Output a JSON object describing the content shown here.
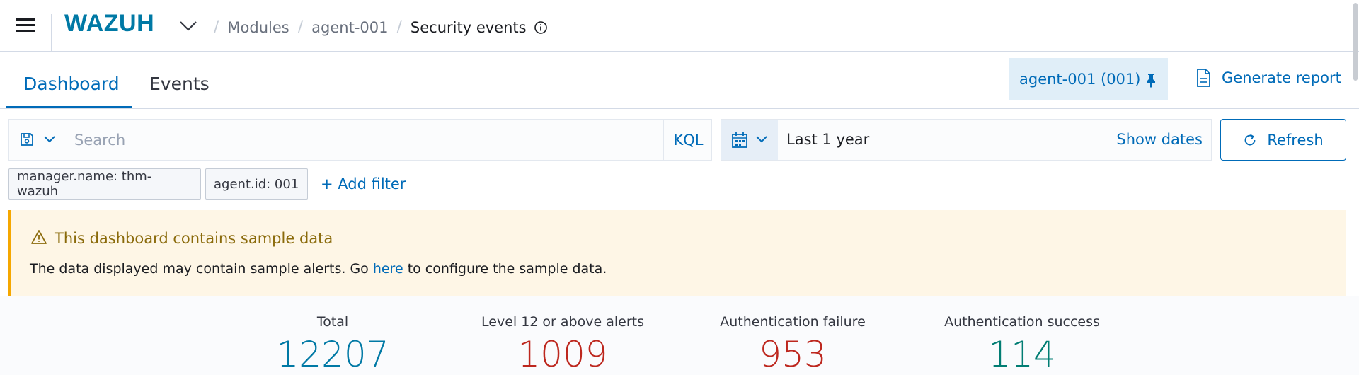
{
  "header": {
    "logo": "WAZUH",
    "breadcrumbs": [
      "Modules",
      "agent-001"
    ],
    "current": "Security events"
  },
  "tabs": [
    {
      "label": "Dashboard",
      "active": true
    },
    {
      "label": "Events",
      "active": false
    }
  ],
  "agent_pill": "agent-001 (001)",
  "generate_report": "Generate report",
  "search": {
    "placeholder": "Search",
    "value": "",
    "language": "KQL"
  },
  "date_picker": {
    "range": "Last 1 year",
    "show_dates": "Show dates"
  },
  "refresh": "Refresh",
  "filters": [
    "manager.name: thm-wazuh",
    "agent.id: 001"
  ],
  "add_filter": "+ Add filter",
  "callout": {
    "title": "This dashboard contains sample data",
    "body_before": "The data displayed may contain sample alerts. Go ",
    "link": "here",
    "body_after": " to configure the sample data."
  },
  "stats": [
    {
      "label": "Total",
      "value": "12207",
      "color": "#0079a5"
    },
    {
      "label": "Level 12 or above alerts",
      "value": "1009",
      "color": "#bd271e"
    },
    {
      "label": "Authentication failure",
      "value": "953",
      "color": "#bd271e"
    },
    {
      "label": "Authentication success",
      "value": "114",
      "color": "#017d73"
    }
  ],
  "colors": {
    "accent": "#006bb8",
    "warning": "#f5a700",
    "danger": "#bd271e",
    "success": "#017d73"
  },
  "icons": [
    "menu-icon",
    "chevron-down-icon",
    "info-icon",
    "pin-icon",
    "document-icon",
    "save-icon",
    "calendar-icon",
    "refresh-icon",
    "warning-icon"
  ]
}
